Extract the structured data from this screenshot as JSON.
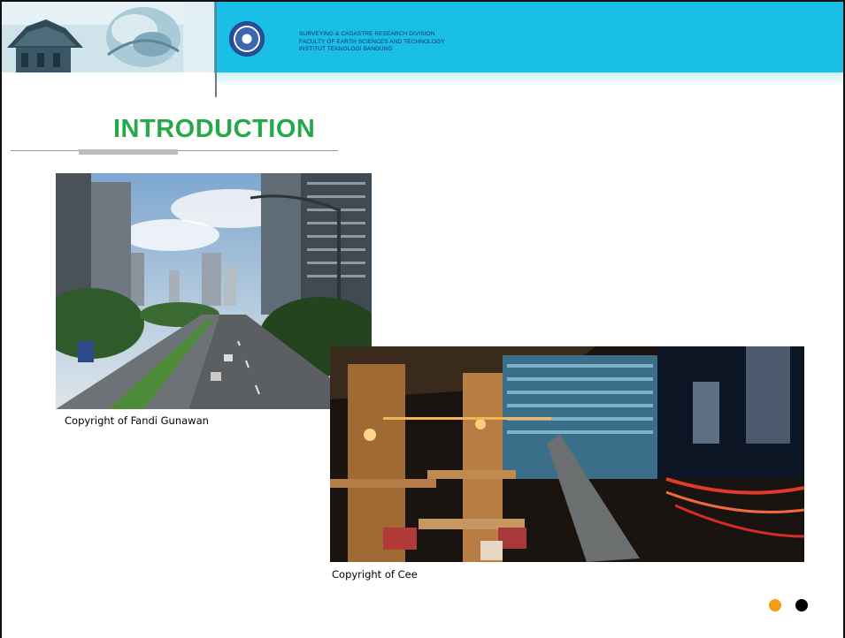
{
  "header": {
    "lines": [
      "SURVEYING & CADASTRE RESEARCH DIVISION",
      "FACULTY OF EARTH SCIENCES AND TECHNOLOGY",
      "INSTITUT TEKNOLOGI BANDUNG"
    ],
    "logo_icon": "university-seal-icon",
    "banner_color": "#19bfe6"
  },
  "slide": {
    "title": "INTRODUCTION",
    "title_color": "#27a84a"
  },
  "photos": [
    {
      "subject": "city-street-photo",
      "caption": "Copyright of  Fandi Gunawan"
    },
    {
      "subject": "rooftop-cafe-photo",
      "caption": "Copyright of  Cee"
    }
  ],
  "footer": {
    "dots": [
      {
        "name": "orange-dot",
        "color": "#f39c1a"
      },
      {
        "name": "black-dot",
        "color": "#000000"
      }
    ]
  }
}
